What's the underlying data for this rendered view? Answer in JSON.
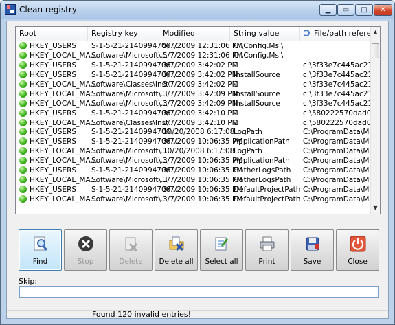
{
  "window": {
    "title": "Clean registry"
  },
  "columns": [
    "Root",
    "Registry key",
    "Modified",
    "String value",
    "File/path refere..."
  ],
  "rows": [
    [
      "HKEY_USERS",
      "S-1-5-21-2140994706...",
      "5/7/2009 12:31:06 PM",
      "C:\\Config.Msi\\",
      ""
    ],
    [
      "HKEY_LOCAL_MA...",
      "Software\\Microsoft\\...",
      "5/7/2009 12:31:06 PM",
      "C:\\Config.Msi\\",
      ""
    ],
    [
      "HKEY_USERS",
      "S-1-5-21-2140994706...",
      "3/7/2009 3:42:02 PM",
      "1",
      "c:\\3f33e7c445ac213..."
    ],
    [
      "HKEY_USERS",
      "S-1-5-21-2140994706...",
      "3/7/2009 3:42:02 PM",
      "InstallSource",
      "c:\\3f33e7c445ac213..."
    ],
    [
      "HKEY_LOCAL_MA...",
      "Software\\Classes\\Inst...",
      "3/7/2009 3:42:02 PM",
      "1",
      "c:\\3f33e7c445ac213..."
    ],
    [
      "HKEY_LOCAL_MA...",
      "Software\\Microsoft\\...",
      "3/7/2009 3:42:09 PM",
      "InstallSource",
      "c:\\3f33e7c445ac213..."
    ],
    [
      "HKEY_LOCAL_MA...",
      "Software\\Microsoft\\...",
      "3/7/2009 3:42:09 PM",
      "InstallSource",
      "c:\\3f33e7c445ac213..."
    ],
    [
      "HKEY_USERS",
      "S-1-5-21-2140994706...",
      "3/7/2009 3:42:10 PM",
      "1",
      "c:\\580222570dad0fcf..."
    ],
    [
      "HKEY_LOCAL_MA...",
      "Software\\Classes\\Inst...",
      "3/7/2009 3:42:10 PM",
      "1",
      "c:\\580222570dad0fcf..."
    ],
    [
      "HKEY_USERS",
      "S-1-5-21-2140994706...",
      "10/20/2008 6:17:08 ...",
      "LogPath",
      "C:\\ProgramData\\Micr..."
    ],
    [
      "HKEY_USERS",
      "S-1-5-21-2140994706...",
      "3/7/2009 10:06:35 PM",
      "ApplicationPath",
      "C:\\ProgramData\\Micr..."
    ],
    [
      "HKEY_LOCAL_MA...",
      "Software\\Microsoft\\...",
      "10/20/2008 6:17:08 ...",
      "LogPath",
      "C:\\ProgramData\\Micr..."
    ],
    [
      "HKEY_LOCAL_MA...",
      "Software\\Microsoft\\...",
      "3/7/2009 10:06:35 PM",
      "ApplicationPath",
      "C:\\ProgramData\\Micr..."
    ],
    [
      "HKEY_USERS",
      "S-1-5-21-2140994706...",
      "3/7/2009 10:06:35 PM",
      "GatherLogsPath",
      "C:\\ProgramData\\Micr..."
    ],
    [
      "HKEY_LOCAL_MA...",
      "Software\\Microsoft\\...",
      "3/7/2009 10:06:35 PM",
      "GatherLogsPath",
      "C:\\ProgramData\\Micr..."
    ],
    [
      "HKEY_USERS",
      "S-1-5-21-2140994706...",
      "3/7/2009 10:06:35 PM",
      "DefaultProjectPath",
      "C:\\ProgramData\\Micr..."
    ],
    [
      "HKEY_LOCAL_MA...",
      "Software\\Microsoft\\...",
      "3/7/2009 10:06:35 PM",
      "DefaultProjectPath",
      "C:\\ProgramData\\Micr..."
    ]
  ],
  "toolbar": {
    "find": "Find",
    "stop": "Stop",
    "delete": "Delete",
    "delete_all": "Delete all",
    "select_all": "Select all",
    "print": "Print",
    "save": "Save",
    "close": "Close"
  },
  "skip": {
    "label": "Skip:",
    "value": ""
  },
  "status": {
    "text": "Found 120 invalid entries!"
  },
  "colors": {
    "valid_dot": "#3fb61c",
    "close_button": "#d0472a",
    "titlebar": "#b9d1ec"
  }
}
